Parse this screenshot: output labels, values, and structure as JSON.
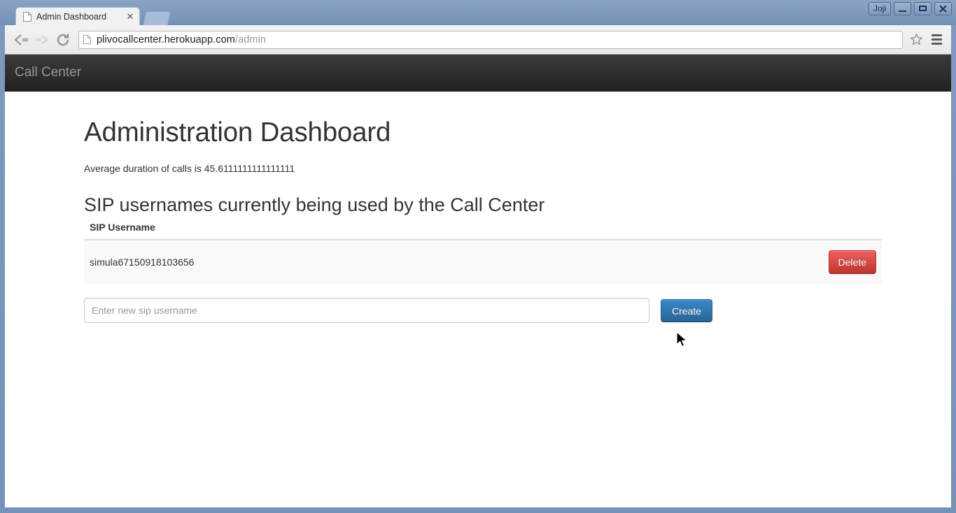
{
  "window": {
    "app_label": "Joji",
    "minimize_label": "—",
    "maximize_label": "□",
    "close_label": "✕"
  },
  "browser": {
    "tab": {
      "title": "Admin Dashboard",
      "close_label": "✕",
      "favicon": "page-icon"
    },
    "new_tab_label": "",
    "back_label": "Back",
    "forward_label": "Forward",
    "reload_label": "Reload",
    "url": {
      "host": "plivocallcenter.herokuapp.com",
      "path": "/admin"
    },
    "bookmark_label": "Bookmark",
    "menu_label": "Menu"
  },
  "page": {
    "navbar_brand": "Call Center",
    "title": "Administration Dashboard",
    "avg_duration_text": "Average duration of calls is 45.6111111111111111",
    "section_title": "SIP usernames currently being used by the Call Center",
    "table": {
      "columns": [
        "SIP Username"
      ],
      "rows": [
        {
          "username": "simula67150918103656",
          "action_label": "Delete"
        }
      ]
    },
    "create_form": {
      "input_value": "",
      "input_placeholder": "Enter new sip username",
      "submit_label": "Create"
    }
  },
  "colors": {
    "navbar_dark": "#222222",
    "danger": "#bd362f",
    "primary": "#2a6496",
    "text": "#333333",
    "muted": "#999999",
    "row_bg": "#f9f9f9",
    "frame_blue": "#7e99bd"
  }
}
